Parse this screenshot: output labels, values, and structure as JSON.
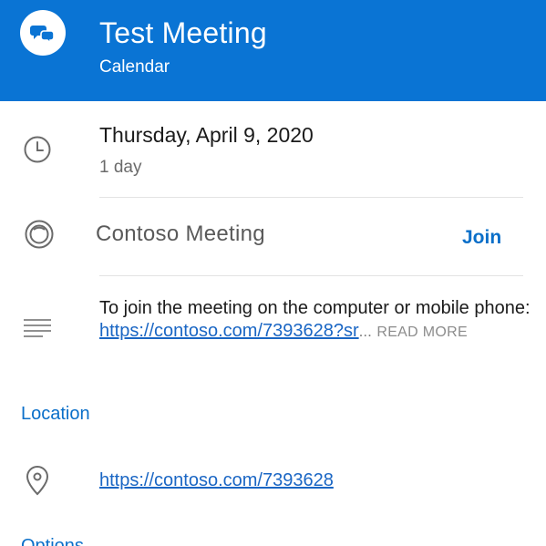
{
  "header": {
    "title": "Test Meeting",
    "subtitle": "Calendar",
    "icon": "chat-bubbles-icon",
    "background_color": "#0a74d4"
  },
  "event": {
    "date": "Thursday, April 9, 2020",
    "duration": "1 day"
  },
  "meeting": {
    "name": "Contoso Meeting",
    "join_label": "Join"
  },
  "description": {
    "text": "To join the meeting on the computer or mobile phone: ",
    "link": "https://contoso.com/7393628?sr",
    "ellipsis": "...",
    "read_more": "READ MORE"
  },
  "location": {
    "heading": "Location",
    "link": "https://contoso.com/7393628"
  },
  "options": {
    "heading": "Options"
  },
  "colors": {
    "accent": "#0a6fc9",
    "link": "#1a66c4"
  }
}
